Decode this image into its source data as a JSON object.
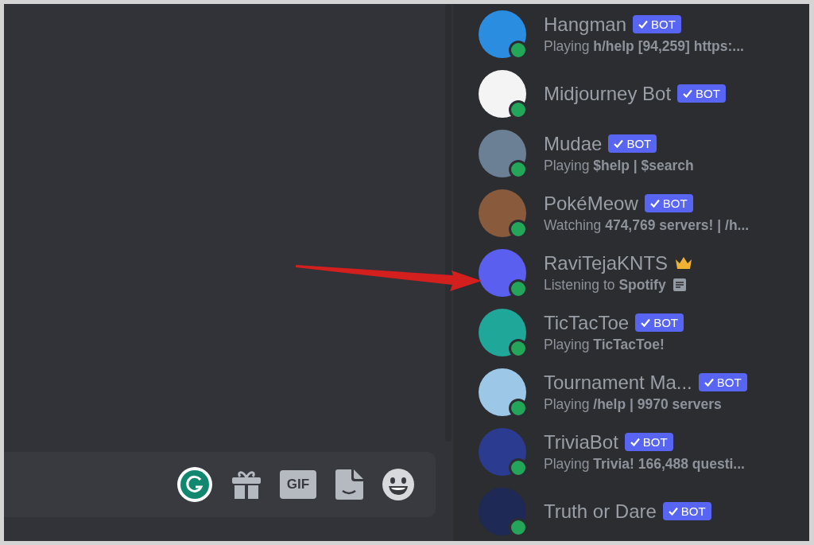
{
  "composer": {
    "tools": [
      {
        "kind": "grammar"
      },
      {
        "kind": "gift"
      },
      {
        "kind": "gif",
        "label": "GIF"
      },
      {
        "kind": "sticker"
      },
      {
        "kind": "emoji"
      }
    ]
  },
  "members": [
    {
      "name": "Hangman",
      "tag": {
        "kind": "bot",
        "label": "BOT"
      },
      "activity": "Playing **h/help [94,259] https:...**",
      "rich_presence": false
    },
    {
      "name": "Midjourney Bot",
      "tag": {
        "kind": "bot",
        "label": "BOT"
      },
      "rich_presence": false
    },
    {
      "name": "Mudae",
      "tag": {
        "kind": "bot",
        "label": "BOT"
      },
      "activity": "Playing **$help | $search**",
      "rich_presence": false
    },
    {
      "name": "PokéMeow",
      "tag": {
        "kind": "bot",
        "label": "BOT"
      },
      "activity": "Watching **474,769 servers! | /h...**",
      "rich_presence": false
    },
    {
      "name": "RaviTejaKNTS",
      "tag": {
        "kind": "owner"
      },
      "activity": "Listening to **Spotify**",
      "rich_presence": true
    },
    {
      "name": "TicTacToe",
      "tag": {
        "kind": "bot",
        "label": "BOT"
      },
      "activity": "Playing **TicTacToe!**",
      "rich_presence": false
    },
    {
      "name": "Tournament Ma...",
      "tag": {
        "kind": "bot",
        "label": "BOT"
      },
      "activity": "Playing **/help | 9970 servers**",
      "rich_presence": false
    },
    {
      "name": "TriviaBot",
      "tag": {
        "kind": "bot",
        "label": "BOT"
      },
      "activity": "Playing **Trivia! 166,488 questi...**",
      "rich_presence": false
    },
    {
      "name": "Truth or Dare",
      "tag": {
        "kind": "bot",
        "label": "BOT"
      },
      "rich_presence": false
    }
  ]
}
